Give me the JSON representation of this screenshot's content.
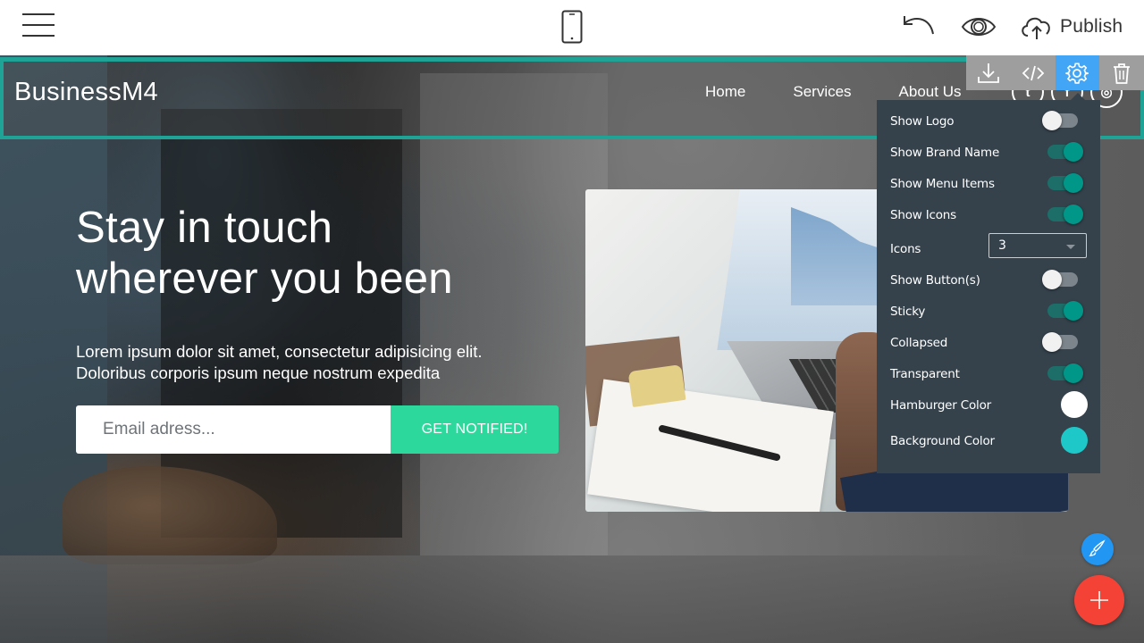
{
  "toolbar": {
    "publish_label": "Publish",
    "icons": [
      "hamburger-menu-icon",
      "mobile-device-icon",
      "undo-icon",
      "preview-eye-icon",
      "cloud-upload-icon"
    ]
  },
  "navbar": {
    "brand": "BusinessM4",
    "links": [
      "Home",
      "Services",
      "About Us"
    ],
    "socials": [
      "twitter",
      "facebook",
      "instagram"
    ],
    "outline_color": "#1fa396"
  },
  "block_toolbar": {
    "buttons": [
      {
        "icon": "download-icon",
        "active": false
      },
      {
        "icon": "code-icon",
        "active": false
      },
      {
        "icon": "gear-icon",
        "active": true
      },
      {
        "icon": "trash-icon",
        "active": false
      }
    ],
    "active_color": "#42a5f5"
  },
  "settings": {
    "items": [
      {
        "label": "Show Logo",
        "type": "toggle",
        "value": false
      },
      {
        "label": "Show Brand Name",
        "type": "toggle",
        "value": true
      },
      {
        "label": "Show Menu Items",
        "type": "toggle",
        "value": true
      },
      {
        "label": "Show Icons",
        "type": "toggle",
        "value": true
      },
      {
        "label": "Icons",
        "type": "select",
        "value": "3"
      },
      {
        "label": "Show Button(s)",
        "type": "toggle",
        "value": false
      },
      {
        "label": "Sticky",
        "type": "toggle",
        "value": true
      },
      {
        "label": "Collapsed",
        "type": "toggle",
        "value": false
      },
      {
        "label": "Transparent",
        "type": "toggle",
        "value": true
      },
      {
        "label": "Hamburger Color",
        "type": "color",
        "value": "#ffffff"
      },
      {
        "label": "Background Color",
        "type": "color",
        "value": "#1fc8c8"
      }
    ]
  },
  "hero": {
    "title_line1": "Stay in touch",
    "title_line2": "wherever you been",
    "text_line1": "Lorem ipsum dolor sit amet, consectetur adipisicing elit.",
    "text_line2": "Doloribus corporis ipsum neque nostrum expedita",
    "email_placeholder": "Email adress...",
    "email_value": "",
    "button_label": "GET NOTIFIED!",
    "button_color": "#2dd89c"
  },
  "fabs": {
    "style_color": "#2196f3",
    "add_color": "#f44336"
  }
}
